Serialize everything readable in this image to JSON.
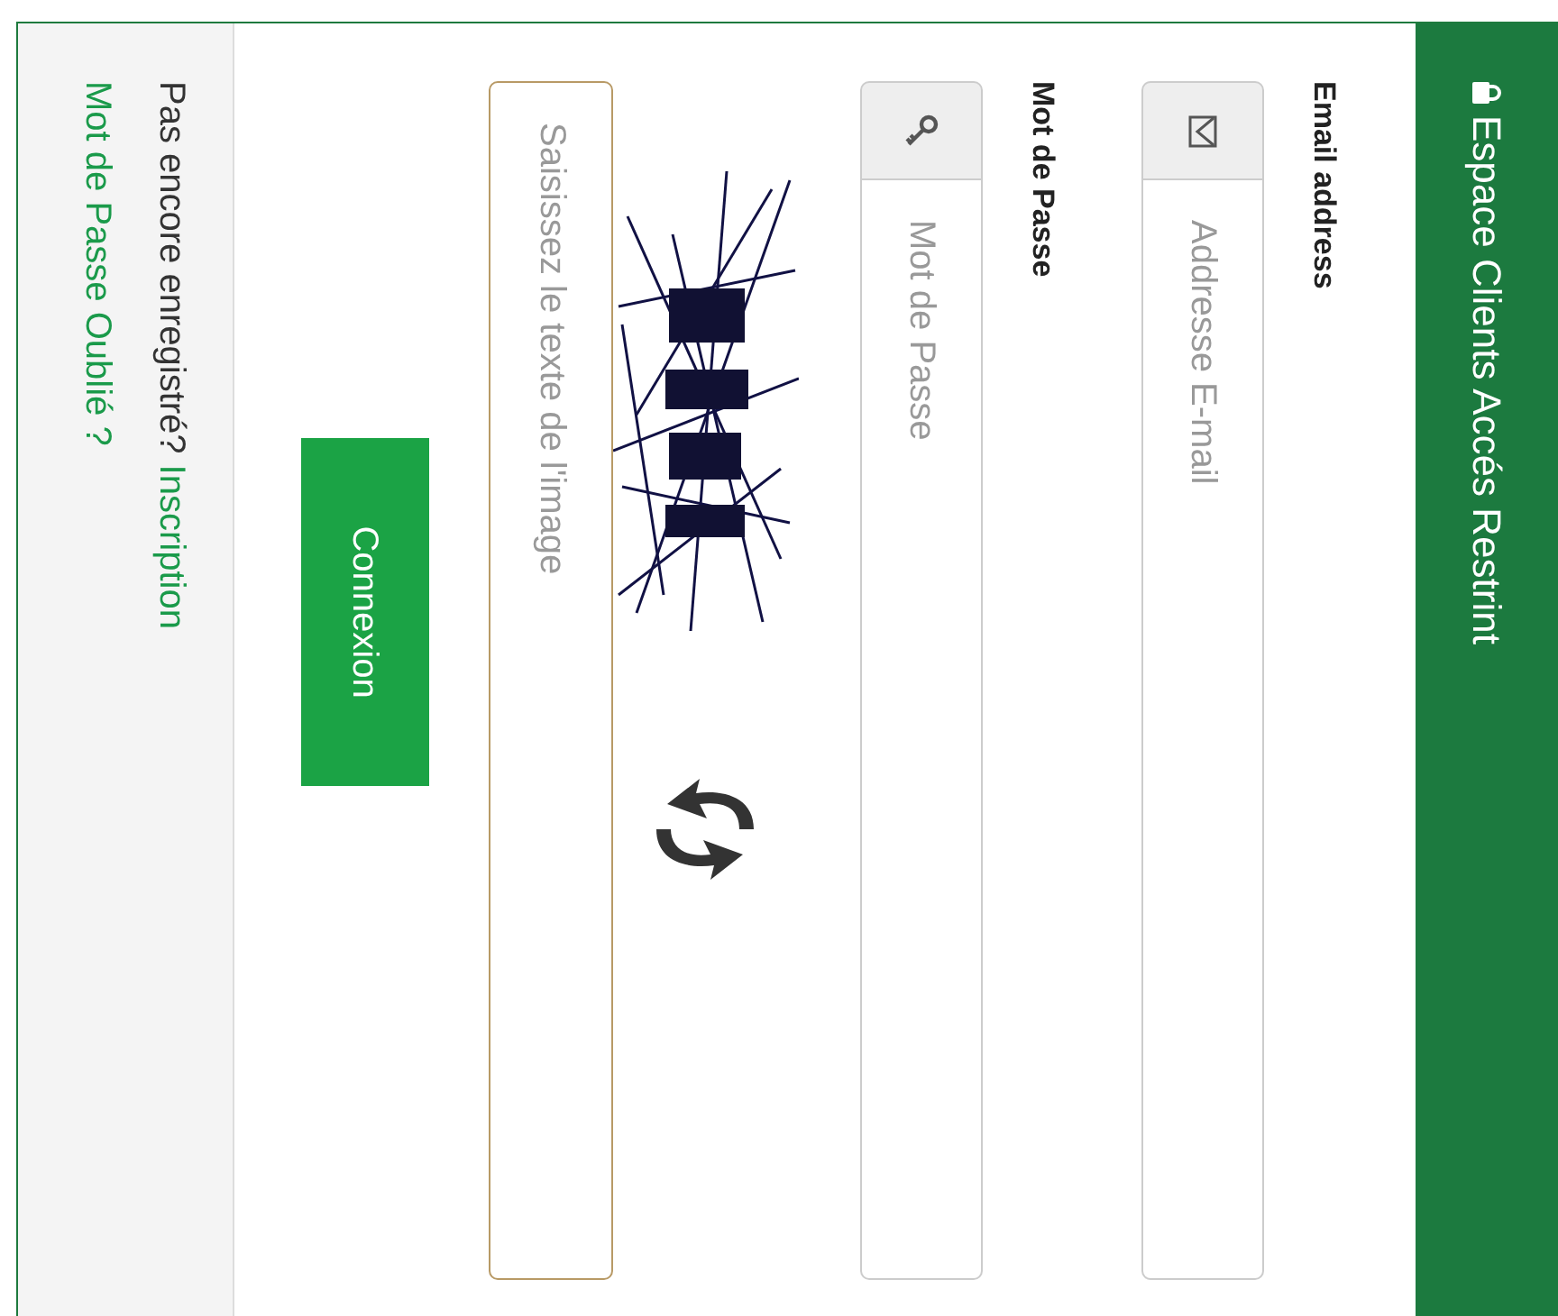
{
  "panel": {
    "title": "Espace Clients Accés Restrint"
  },
  "fields": [
    {
      "kind": "email",
      "label": "Email address",
      "placeholder": "Addresse E-mail"
    },
    {
      "kind": "password",
      "label": "Mot de Passe",
      "placeholder": "Mot de Passe"
    }
  ],
  "captcha": {
    "placeholder": "Saisissez le texte de l'image"
  },
  "submit": "Connexion",
  "footer": {
    "prompt": "Pas encore enregistré?",
    "register_link": "Inscription",
    "forgot_link": "Mot de Passe Oublié ?"
  }
}
